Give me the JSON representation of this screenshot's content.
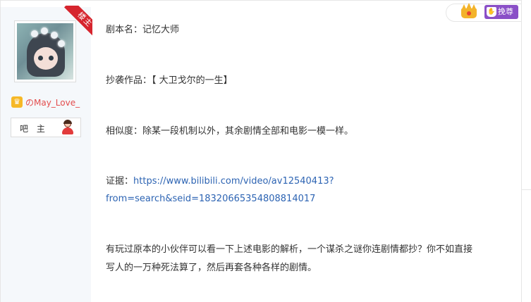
{
  "author": {
    "username": "のMay_Love_",
    "badge": "楼主",
    "level_icon": "crown-level-icon",
    "role": "吧 主"
  },
  "header_actions": {
    "crown_icon": "crown-icon",
    "respect_label": "挽尊"
  },
  "post": {
    "line1": "剧本名：记忆大师",
    "line2": "抄袭作品：【 大卫戈尔的一生】",
    "line3": "相似度：除某一段机制以外，其余剧情全部和电影一模一样。",
    "evidence_label": "证据：",
    "evidence_link_part1": "https://www.bilibili.com/video/av12540413?",
    "evidence_link_part2": "from=search&seid=18320665354808814017",
    "line5a": "有玩过原本的小伙伴可以看一下上述电影的解析，一个谋杀之谜你连剧情都抄？你不如直接",
    "line5b": "写人的一万种死法算了，然后再套各种各样的剧情。"
  },
  "colors": {
    "badge_red": "#d6252e",
    "username_red": "#e34c4c",
    "link_blue": "#2d64b3",
    "respect_purple": "#8a4fc7",
    "crown_gold": "#f3b32a"
  }
}
